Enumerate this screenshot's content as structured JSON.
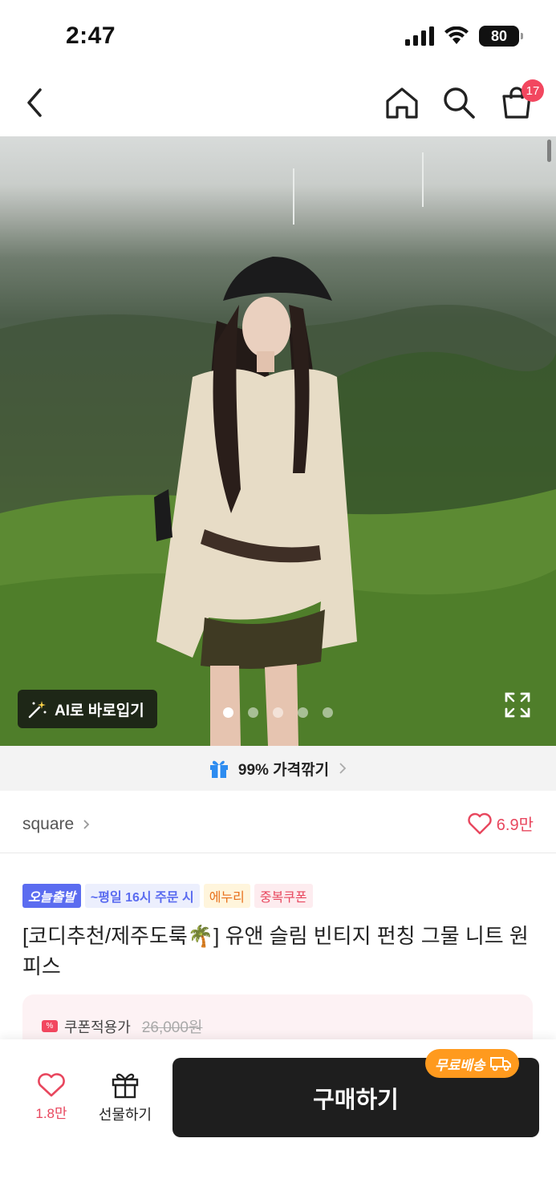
{
  "status_bar": {
    "time": "2:47",
    "battery": "80"
  },
  "nav": {
    "cart_count": "17"
  },
  "hero": {
    "ai_try_label": "AI로 바로입기",
    "page_count": 5,
    "active_page": 0
  },
  "price_cut": {
    "label": "99% 가격깎기"
  },
  "shop": {
    "name": "square",
    "likes": "6.9만"
  },
  "tags": [
    {
      "text": "오늘출발"
    },
    {
      "text": "~평일 16시 주문 시"
    },
    {
      "text": "에누리"
    },
    {
      "text": "중복쿠폰"
    }
  ],
  "product": {
    "title": "[코디추천/제주도룩🌴] 유앤 슬림 빈티지 펀칭 그물 니트 원피스"
  },
  "coupon": {
    "label": "쿠폰적용가",
    "original_price": "26,000원"
  },
  "bottom": {
    "like_count": "1.8만",
    "gift_label": "선물하기",
    "buy_label": "구매하기",
    "free_shipping": "무료배송"
  },
  "colors": {
    "accent_red": "#f2475f",
    "brand_blue": "#5b6cf0",
    "ship_orange": "#ff9a1e",
    "buy_black": "#1e1e1e"
  }
}
